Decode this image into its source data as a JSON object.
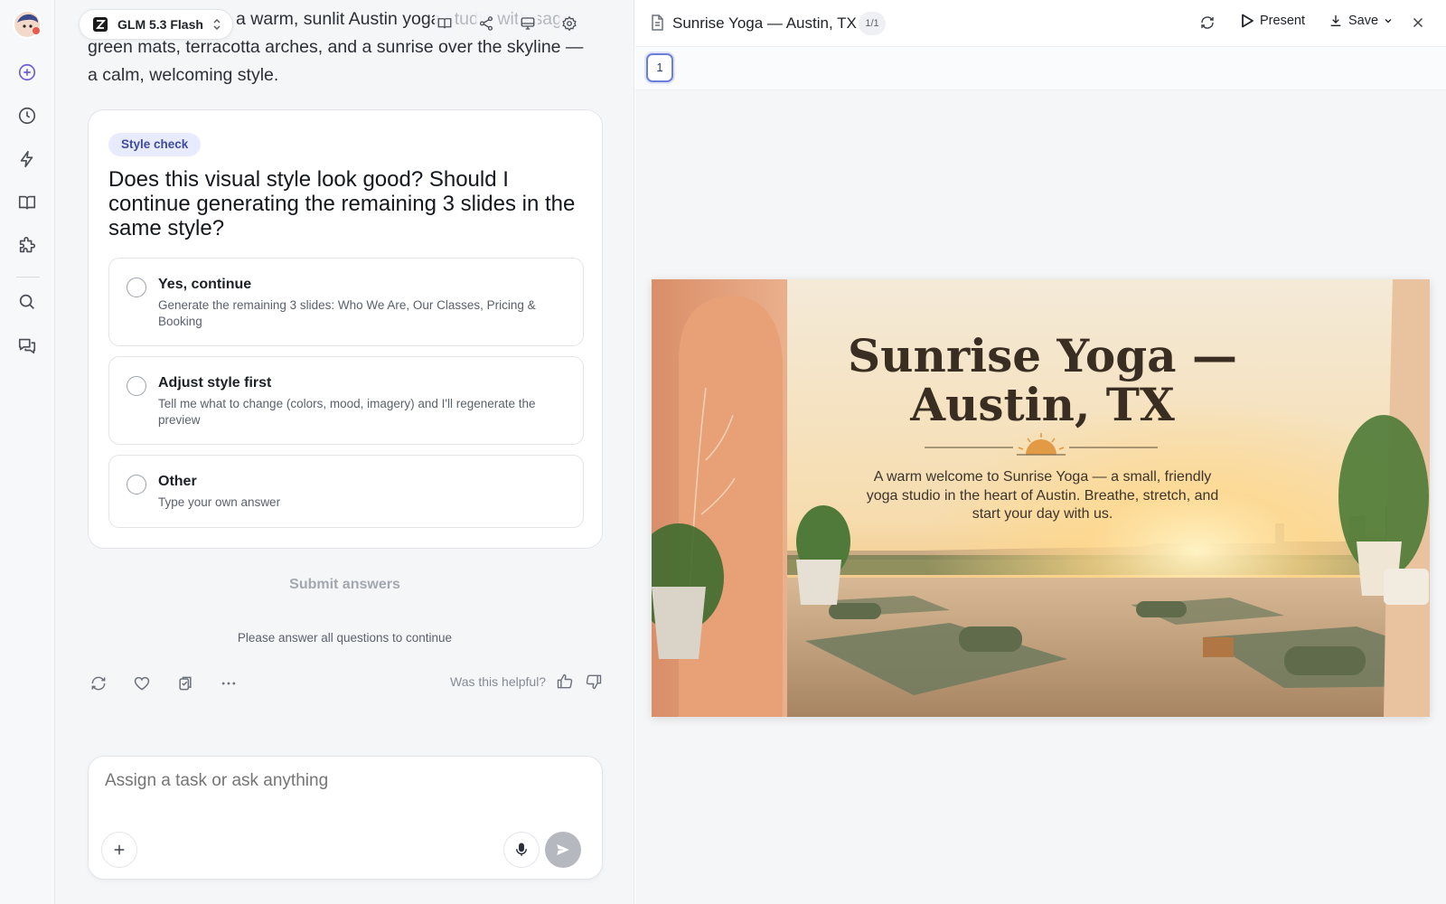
{
  "app": {
    "model_name": "GLM 5.3 Flash"
  },
  "chat": {
    "intro_visible": "a warm, sunlit Austin yoga",
    "intro_hidden": " studio with sage",
    "intro_line2": "green mats, terracotta arches, and a sunrise over the skyline — a calm, welcoming style."
  },
  "question_card": {
    "badge": "Style check",
    "question": "Does this visual style look good? Should I continue generating the remaining 3 slides in the same style?",
    "options": [
      {
        "title": "Yes, continue",
        "desc": "Generate the remaining 3 slides: Who We Are, Our Classes, Pricing & Booking"
      },
      {
        "title": "Adjust style first",
        "desc": "Tell me what to change (colors, mood, imagery) and I'll regenerate the preview"
      },
      {
        "title": "Other",
        "desc": "Type your own answer"
      }
    ],
    "submit_label": "Submit answers",
    "hint": "Please answer all questions to continue"
  },
  "feedback": {
    "helpful_label": "Was this helpful?"
  },
  "composer": {
    "placeholder": "Assign a task or ask anything"
  },
  "preview": {
    "title": "Sunrise Yoga — Austin, TX",
    "page_count": "1/1",
    "present_label": "Present",
    "save_label": "Save",
    "thumbnails": [
      "1"
    ],
    "slide": {
      "title": "Sunrise Yoga — Austin, TX",
      "subtitle": "A warm welcome to Sunrise Yoga — a small, friendly yoga studio in the heart of Austin. Breathe, stretch, and start your day with us."
    }
  },
  "colors": {
    "accent": "#6c7fd6",
    "badge_bg": "#e8ebfb",
    "badge_text": "#3e4a9e",
    "send_disabled": "#b5b9bf"
  },
  "icons": {
    "rail": [
      "avatar-icon",
      "new-task-icon",
      "history-icon",
      "bolt-icon",
      "book-icon",
      "puzzle-icon",
      "search-icon",
      "chat-icon"
    ],
    "header": [
      "library-icon",
      "share-icon",
      "monitor-icon",
      "settings-icon"
    ],
    "actions": [
      "retry-icon",
      "heart-icon",
      "copy-icon",
      "more-icon"
    ]
  }
}
